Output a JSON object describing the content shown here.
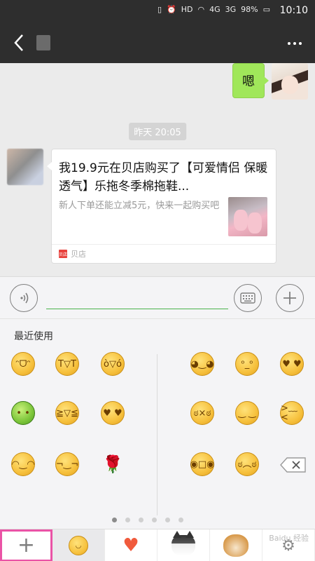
{
  "status_bar": {
    "network": "HD",
    "signal1": "4G",
    "signal2": "3G",
    "battery": "98%",
    "time": "10:10"
  },
  "header": {
    "back_icon": "back-arrow-icon",
    "more_icon": "more-dots-icon"
  },
  "chat": {
    "outgoing_text": "嗯",
    "timestamp": "昨天 20:05",
    "card": {
      "title": "我19.9元在贝店购买了【可爱情侣 保暖透气】乐拖冬季棉拖鞋...",
      "description": "新人下单还能立减5元，快来一起购买吧",
      "source_logo_text": "贝店",
      "source_name": "贝店"
    }
  },
  "input_bar": {
    "voice_icon": "voice-icon",
    "keyboard_icon": "keyboard-icon",
    "plus_icon": "plus-icon",
    "input_value": ""
  },
  "emoji_panel": {
    "section_label": "最近使用",
    "emojis_left": [
      {
        "name": "grin-emoji",
        "glyph": "ᵔᗜᵔ"
      },
      {
        "name": "cry-laugh-emoji",
        "glyph": "T▽T"
      },
      {
        "name": "grimace-emoji",
        "glyph": "ò▽ó"
      },
      {
        "name": "green-guy-emoji",
        "glyph": "• •"
      },
      {
        "name": "tears-joy-emoji",
        "glyph": "≧▽≦"
      },
      {
        "name": "heart-eyes-emoji",
        "glyph": "♥ ♥"
      },
      {
        "name": "smile-emoji",
        "glyph": "◠‿◠"
      },
      {
        "name": "smirk-emoji",
        "glyph": "¬‿¬"
      },
      {
        "name": "rose-emoji",
        "glyph": "🌹"
      }
    ],
    "emojis_right": [
      {
        "name": "smile2-emoji",
        "glyph": "◕‿◕"
      },
      {
        "name": "awkward-emoji",
        "glyph": "ᵒ_ᵒ"
      },
      {
        "name": "love-emoji",
        "glyph": "♥ ♥"
      },
      {
        "name": "shush-emoji",
        "glyph": "ಠ×ಠ"
      },
      {
        "name": "sleepy-emoji",
        "glyph": "‿ ‿"
      },
      {
        "name": "crying-emoji",
        "glyph": ">﹏<"
      },
      {
        "name": "scared-emoji",
        "glyph": "◉□◉"
      },
      {
        "name": "frown-emoji",
        "glyph": "ಠ︵ಠ"
      }
    ],
    "pager_pages": 6,
    "pager_active": 0
  },
  "tabbar": {
    "watermark": "Baidu 经验"
  },
  "colors": {
    "header_bg": "#2e2e2e",
    "bubble_green": "#a0e75a",
    "input_underline": "#4ab34c",
    "highlight_box": "#ea53a6"
  }
}
